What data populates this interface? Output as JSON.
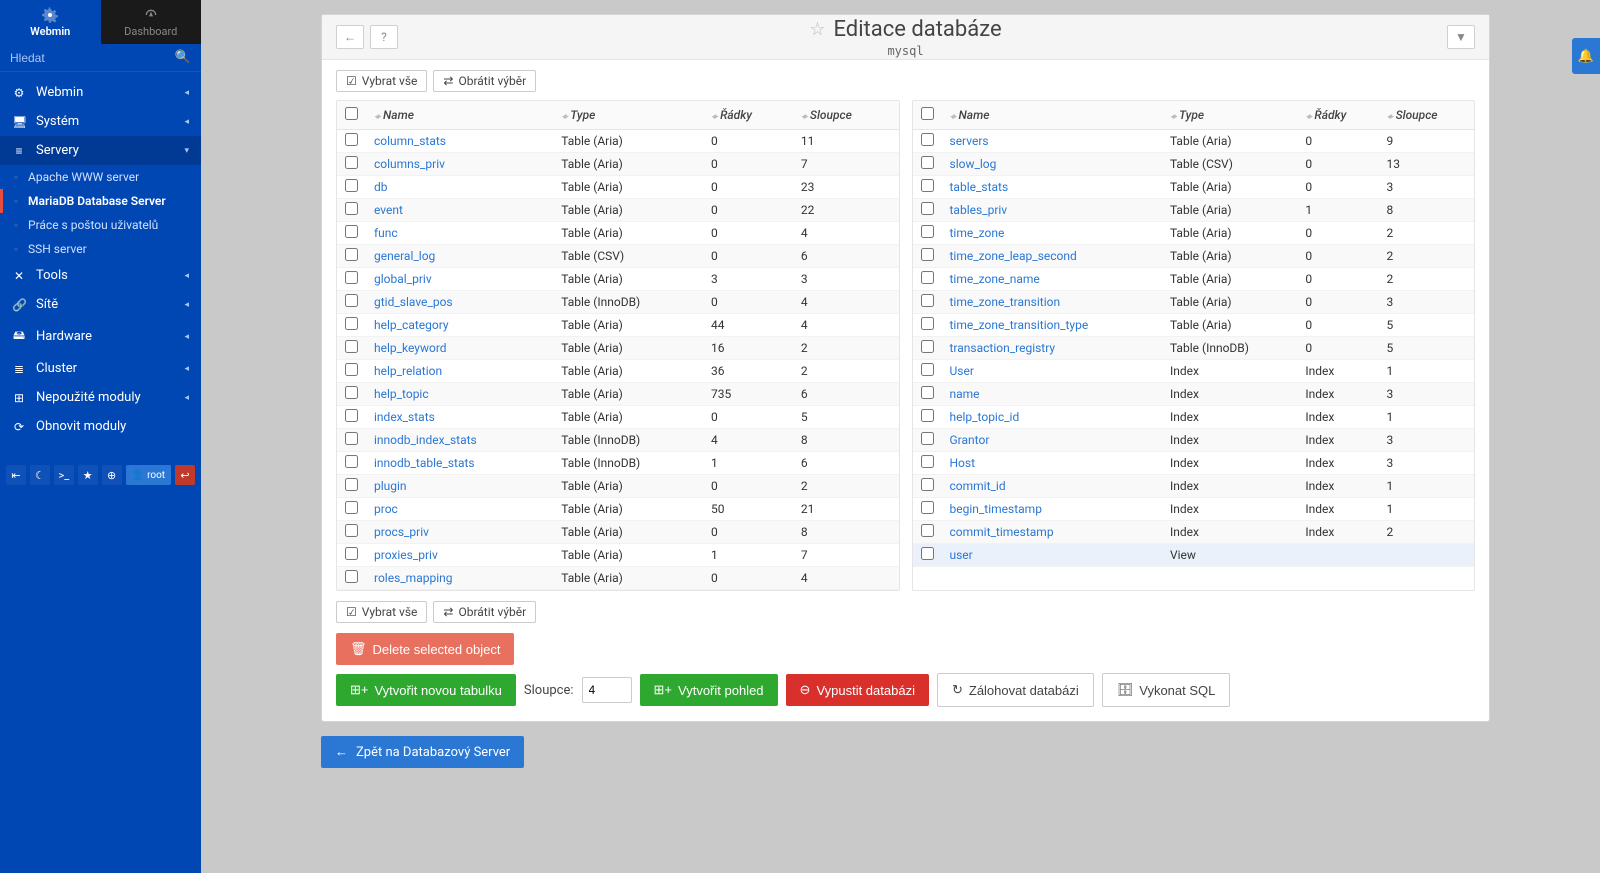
{
  "sidebar": {
    "tabs": {
      "webmin": "Webmin",
      "dashboard": "Dashboard"
    },
    "search_placeholder": "Hledat",
    "items": [
      {
        "icon": "⚙",
        "label": "Webmin",
        "chev": "◂"
      },
      {
        "icon": "🖥",
        "label": "Systém",
        "chev": "◂"
      },
      {
        "icon": "≡",
        "label": "Servery",
        "chev": "▾",
        "expanded": true,
        "children": [
          {
            "label": "Apache WWW server"
          },
          {
            "label": "MariaDB Database Server",
            "active": true
          },
          {
            "label": "Práce s poštou uživatelů"
          },
          {
            "label": "SSH server"
          }
        ]
      },
      {
        "icon": "✕",
        "label": "Tools",
        "chev": "◂"
      },
      {
        "icon": "🔗",
        "label": "Sítě",
        "chev": "◂"
      },
      {
        "icon": "🖴",
        "label": "Hardware",
        "chev": "◂"
      },
      {
        "icon": "≣",
        "label": "Cluster",
        "chev": "◂"
      },
      {
        "icon": "⊞",
        "label": "Nepoužité moduly",
        "chev": "◂"
      },
      {
        "icon": "⟳",
        "label": "Obnovit moduly"
      }
    ],
    "user": "root"
  },
  "header": {
    "title": "Editace databáze",
    "subtitle": "mysql"
  },
  "toolbar": {
    "select_all": "Vybrat vše",
    "invert": "Obrátit výběr"
  },
  "columns": {
    "name": "Name",
    "type": "Type",
    "rows": "Řádky",
    "cols": "Sloupce"
  },
  "tables_left": [
    {
      "name": "column_stats",
      "type": "Table (Aria)",
      "rows": "0",
      "cols": "11"
    },
    {
      "name": "columns_priv",
      "type": "Table (Aria)",
      "rows": "0",
      "cols": "7"
    },
    {
      "name": "db",
      "type": "Table (Aria)",
      "rows": "0",
      "cols": "23"
    },
    {
      "name": "event",
      "type": "Table (Aria)",
      "rows": "0",
      "cols": "22"
    },
    {
      "name": "func",
      "type": "Table (Aria)",
      "rows": "0",
      "cols": "4"
    },
    {
      "name": "general_log",
      "type": "Table (CSV)",
      "rows": "0",
      "cols": "6"
    },
    {
      "name": "global_priv",
      "type": "Table (Aria)",
      "rows": "3",
      "cols": "3"
    },
    {
      "name": "gtid_slave_pos",
      "type": "Table (InnoDB)",
      "rows": "0",
      "cols": "4"
    },
    {
      "name": "help_category",
      "type": "Table (Aria)",
      "rows": "44",
      "cols": "4"
    },
    {
      "name": "help_keyword",
      "type": "Table (Aria)",
      "rows": "16",
      "cols": "2"
    },
    {
      "name": "help_relation",
      "type": "Table (Aria)",
      "rows": "36",
      "cols": "2"
    },
    {
      "name": "help_topic",
      "type": "Table (Aria)",
      "rows": "735",
      "cols": "6"
    },
    {
      "name": "index_stats",
      "type": "Table (Aria)",
      "rows": "0",
      "cols": "5"
    },
    {
      "name": "innodb_index_stats",
      "type": "Table (InnoDB)",
      "rows": "4",
      "cols": "8"
    },
    {
      "name": "innodb_table_stats",
      "type": "Table (InnoDB)",
      "rows": "1",
      "cols": "6"
    },
    {
      "name": "plugin",
      "type": "Table (Aria)",
      "rows": "0",
      "cols": "2"
    },
    {
      "name": "proc",
      "type": "Table (Aria)",
      "rows": "50",
      "cols": "21"
    },
    {
      "name": "procs_priv",
      "type": "Table (Aria)",
      "rows": "0",
      "cols": "8"
    },
    {
      "name": "proxies_priv",
      "type": "Table (Aria)",
      "rows": "1",
      "cols": "7"
    },
    {
      "name": "roles_mapping",
      "type": "Table (Aria)",
      "rows": "0",
      "cols": "4"
    }
  ],
  "tables_right": [
    {
      "name": "servers",
      "type": "Table (Aria)",
      "rows": "0",
      "cols": "9"
    },
    {
      "name": "slow_log",
      "type": "Table (CSV)",
      "rows": "0",
      "cols": "13"
    },
    {
      "name": "table_stats",
      "type": "Table (Aria)",
      "rows": "0",
      "cols": "3"
    },
    {
      "name": "tables_priv",
      "type": "Table (Aria)",
      "rows": "1",
      "cols": "8"
    },
    {
      "name": "time_zone",
      "type": "Table (Aria)",
      "rows": "0",
      "cols": "2"
    },
    {
      "name": "time_zone_leap_second",
      "type": "Table (Aria)",
      "rows": "0",
      "cols": "2"
    },
    {
      "name": "time_zone_name",
      "type": "Table (Aria)",
      "rows": "0",
      "cols": "2"
    },
    {
      "name": "time_zone_transition",
      "type": "Table (Aria)",
      "rows": "0",
      "cols": "3"
    },
    {
      "name": "time_zone_transition_type",
      "type": "Table (Aria)",
      "rows": "0",
      "cols": "5"
    },
    {
      "name": "transaction_registry",
      "type": "Table (InnoDB)",
      "rows": "0",
      "cols": "5"
    },
    {
      "name": "User",
      "type": "Index",
      "rows": "Index",
      "cols": "1"
    },
    {
      "name": "name",
      "type": "Index",
      "rows": "Index",
      "cols": "3"
    },
    {
      "name": "help_topic_id",
      "type": "Index",
      "rows": "Index",
      "cols": "1"
    },
    {
      "name": "Grantor",
      "type": "Index",
      "rows": "Index",
      "cols": "3"
    },
    {
      "name": "Host",
      "type": "Index",
      "rows": "Index",
      "cols": "3"
    },
    {
      "name": "commit_id",
      "type": "Index",
      "rows": "Index",
      "cols": "1"
    },
    {
      "name": "begin_timestamp",
      "type": "Index",
      "rows": "Index",
      "cols": "1"
    },
    {
      "name": "commit_timestamp",
      "type": "Index",
      "rows": "Index",
      "cols": "2"
    },
    {
      "name": "user",
      "type": "View",
      "rows": "",
      "cols": "",
      "hover": true
    }
  ],
  "actions": {
    "delete": "Delete selected object",
    "new_table": "Vytvořit novou tabulku",
    "cols_label": "Sloupce:",
    "cols_value": "4",
    "create_view": "Vytvořit pohled",
    "drop_db": "Vypustit databázi",
    "backup_db": "Zálohovat databázi",
    "exec_sql": "Vykonat SQL",
    "back": "Zpět na Databazový Server"
  }
}
